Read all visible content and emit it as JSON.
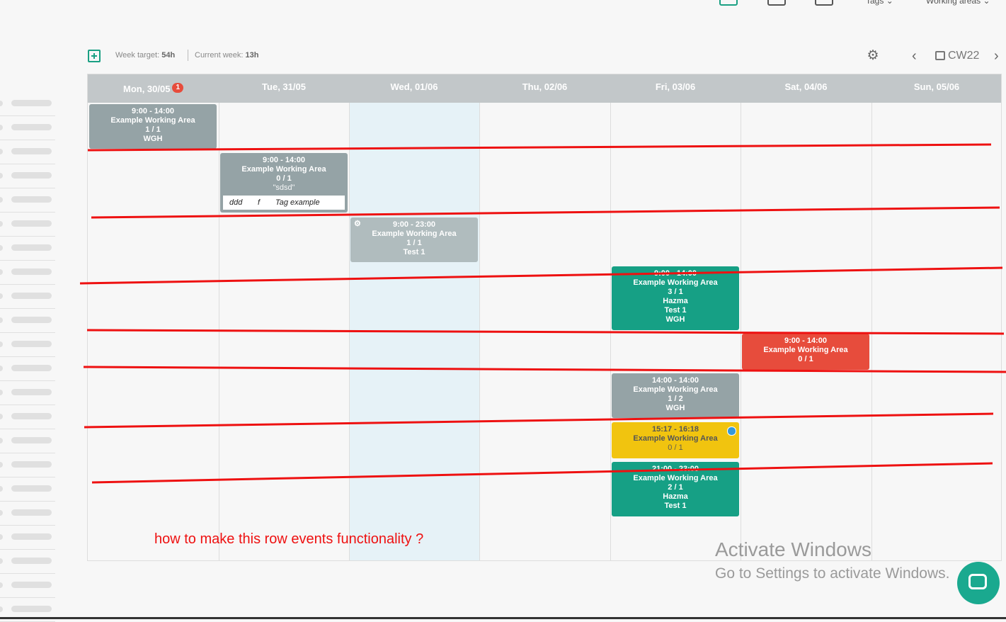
{
  "topbar": {
    "tags_label": "Tags",
    "working_areas_label": "Working areas"
  },
  "toolbar": {
    "week_target_label": "Week target:",
    "week_target_value": "54h",
    "current_week_label": "Current week:",
    "current_week_value": "13h",
    "calendar_week": "CW22"
  },
  "days": [
    {
      "label": "Mon, 30/05",
      "badge": "1"
    },
    {
      "label": "Tue, 31/05"
    },
    {
      "label": "Wed, 01/06"
    },
    {
      "label": "Thu, 02/06"
    },
    {
      "label": "Fri, 03/06"
    },
    {
      "label": "Sat, 04/06"
    },
    {
      "label": "Sun, 05/06"
    }
  ],
  "events": [
    {
      "time": "9:00 - 14:00",
      "area": "Example Working Area",
      "count": "1 / 1",
      "extra": "WGH"
    },
    {
      "time": "9:00 - 14:00",
      "area": "Example Working Area",
      "count": "0 / 1",
      "note": "\"sdsd\"",
      "tags": [
        "ddd",
        "f",
        "Tag example"
      ]
    },
    {
      "time": "9:00 - 23:00",
      "area": "Example Working Area",
      "count": "1 / 1",
      "extra": "Test 1"
    },
    {
      "time": "9:00 - 14:00",
      "area": "Example Working Area",
      "count": "3 / 1",
      "extra1": "Hazma",
      "extra2": "Test 1",
      "extra3": "WGH"
    },
    {
      "time": "9:00 - 14:00",
      "area": "Example Working Area",
      "count": "0 / 1"
    },
    {
      "time": "14:00 - 14:00",
      "area": "Example Working Area",
      "count": "1 / 2",
      "extra": "WGH"
    },
    {
      "time": "15:17 - 16:18",
      "area": "Example Working Area",
      "count": "0 / 1"
    },
    {
      "time": "21:00 - 23:00",
      "area": "Example Working Area",
      "count": "2 / 1",
      "extra1": "Hazma",
      "extra2": "Test 1"
    }
  ],
  "annotation": "how to make this row events functionality ?",
  "watermark": {
    "line1": "Activate Windows",
    "line2": "Go to Settings to activate Windows."
  },
  "colors": {
    "accent": "#1aa083",
    "event_grey": "#95a3a6",
    "event_green": "#16a085",
    "event_red": "#e74c3c",
    "event_yellow": "#f1c40f",
    "annotation_red": "#ee1111"
  }
}
